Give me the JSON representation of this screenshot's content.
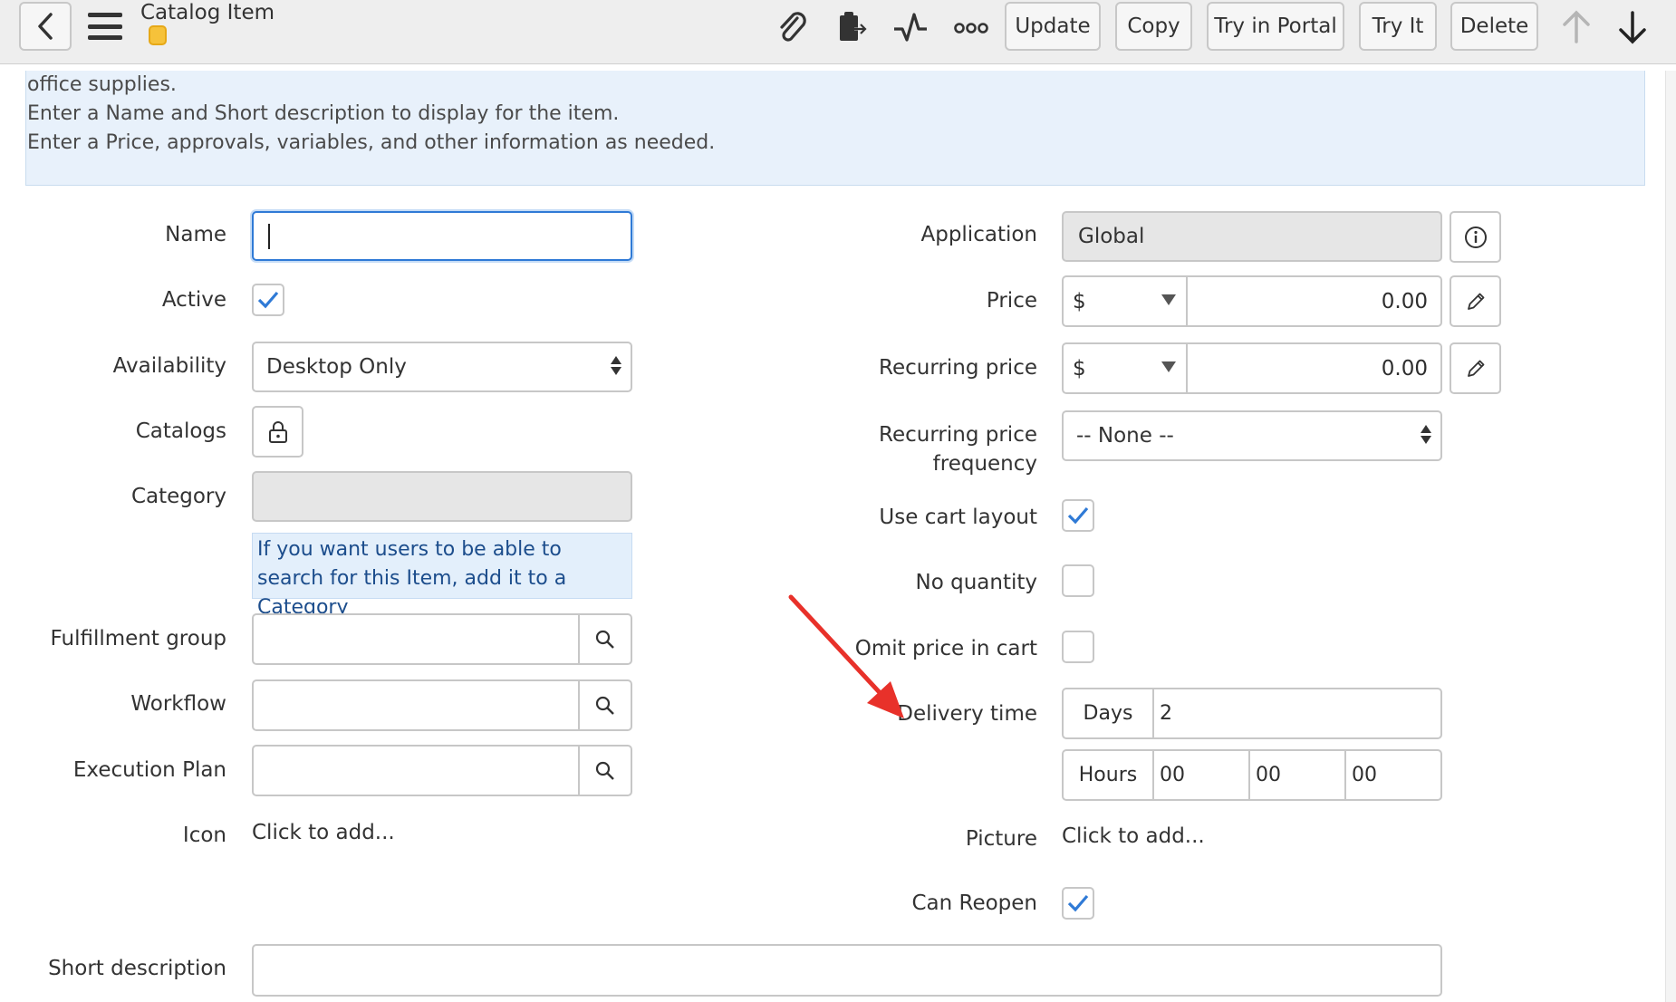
{
  "header": {
    "title": "Catalog Item",
    "buttons": {
      "update": "Update",
      "copy": "Copy",
      "try_in_portal": "Try in Portal",
      "try_it": "Try It",
      "delete": "Delete"
    }
  },
  "info": {
    "lines": [
      "office supplies.",
      "Enter a Name and Short description to display for the item.",
      "Enter a Price, approvals, variables, and other information as needed."
    ]
  },
  "left": {
    "name_label": "Name",
    "name_value": "",
    "active_label": "Active",
    "availability_label": "Availability",
    "availability_value": "Desktop Only",
    "catalogs_label": "Catalogs",
    "category_label": "Category",
    "category_hint": "If you want users to be able to search for this Item, add it to a Category",
    "fulfillment_label": "Fulfillment group",
    "workflow_label": "Workflow",
    "execution_label": "Execution Plan",
    "icon_label": "Icon",
    "icon_value": "Click to add...",
    "short_desc_label": "Short description"
  },
  "right": {
    "application_label": "Application",
    "application_value": "Global",
    "price_label": "Price",
    "price_currency": "$",
    "price_value": "0.00",
    "recurring_label": "Recurring price",
    "recurring_currency": "$",
    "recurring_value": "0.00",
    "recurring_freq_label_1": "Recurring price",
    "recurring_freq_label_2": "frequency",
    "recurring_freq_value": "-- None --",
    "cart_layout_label": "Use cart layout",
    "no_quantity_label": "No quantity",
    "omit_price_label": "Omit price in cart",
    "delivery_label": "Delivery time",
    "days_label": "Days",
    "days_value": "2",
    "hours_label": "Hours",
    "hours_value": "00",
    "minutes_value": "00",
    "seconds_value": "00",
    "picture_label": "Picture",
    "picture_value": "Click to add...",
    "can_reopen_label": "Can Reopen"
  },
  "colors": {
    "accent": "#2f7ad6",
    "arrow": "#e8312a",
    "info_bg": "#e8f1fb"
  },
  "checkboxes": {
    "active": true,
    "use_cart_layout": true,
    "no_quantity": false,
    "omit_price_in_cart": false,
    "can_reopen": true
  }
}
